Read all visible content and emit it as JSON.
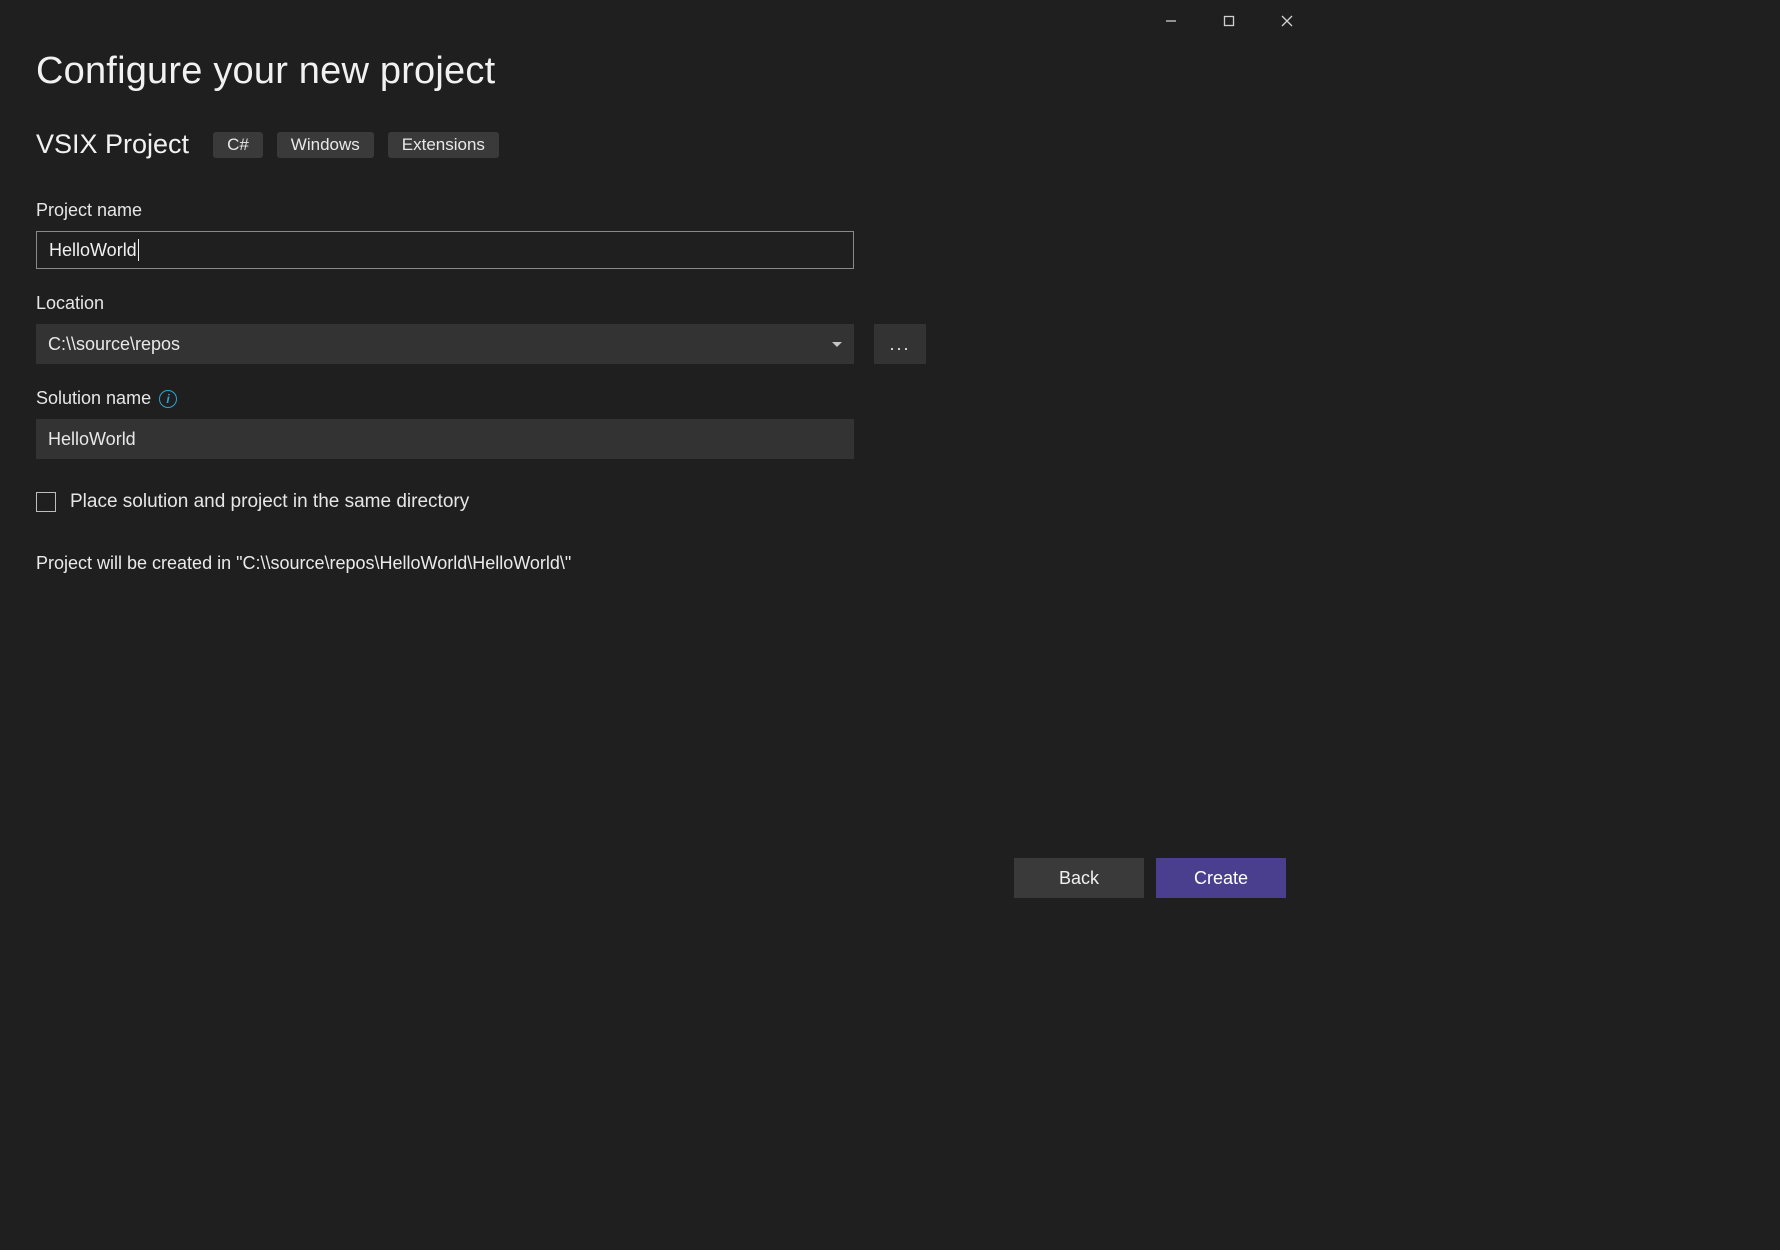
{
  "header": {
    "title": "Configure your new project"
  },
  "subheader": {
    "project_type": "VSIX Project",
    "tags": [
      "C#",
      "Windows",
      "Extensions"
    ]
  },
  "fields": {
    "project_name": {
      "label": "Project name",
      "value": "HelloWorld"
    },
    "location": {
      "label": "Location",
      "value": "C:\\\\source\\repos",
      "browse_label": "..."
    },
    "solution_name": {
      "label": "Solution name",
      "value": "HelloWorld"
    },
    "same_directory": {
      "label": "Place solution and project in the same directory",
      "checked": false
    }
  },
  "summary_text": "Project will be created in \"C:\\\\source\\repos\\HelloWorld\\HelloWorld\\\"",
  "footer": {
    "back_label": "Back",
    "create_label": "Create"
  },
  "window_controls": {
    "minimize": "minimize",
    "maximize": "maximize",
    "close": "close"
  }
}
